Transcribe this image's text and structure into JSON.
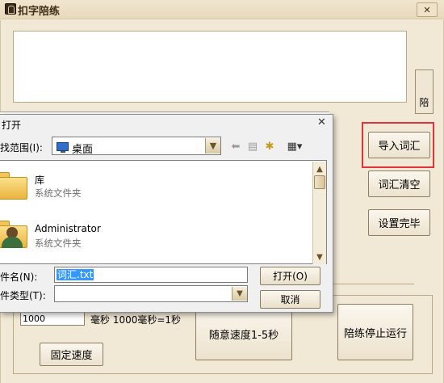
{
  "app": {
    "title": "扣字陪练",
    "close_glyph": "✕"
  },
  "main": {
    "side_button_label": "陪",
    "buttons": {
      "import": "导入词汇",
      "clear": "词汇清空",
      "done": "设置完毕",
      "random_speed": "随意速度1-5秒",
      "stop": "陪练停止运行",
      "fixed_speed": "固定速度"
    },
    "interval_value": "1000",
    "interval_unit_label": "毫秒  1000毫秒=1秒"
  },
  "dialog": {
    "title": "打开",
    "close_glyph": "✕",
    "lookin_label": "找范围(I):",
    "lookin_value": "桌面",
    "items": [
      {
        "name": "库",
        "type": "系统文件夹",
        "icon": "library-folder-icon"
      },
      {
        "name": "Administrator",
        "type": "系统文件夹",
        "icon": "user-folder-icon"
      }
    ],
    "filename_label": "件名(N):",
    "filename_value": "词汇.txt",
    "filetype_label": "件类型(T):",
    "filetype_value": "",
    "open_button": "打开(O)",
    "cancel_button": "取消"
  },
  "colors": {
    "highlight": "#e0343a",
    "selection": "#3399ff"
  }
}
